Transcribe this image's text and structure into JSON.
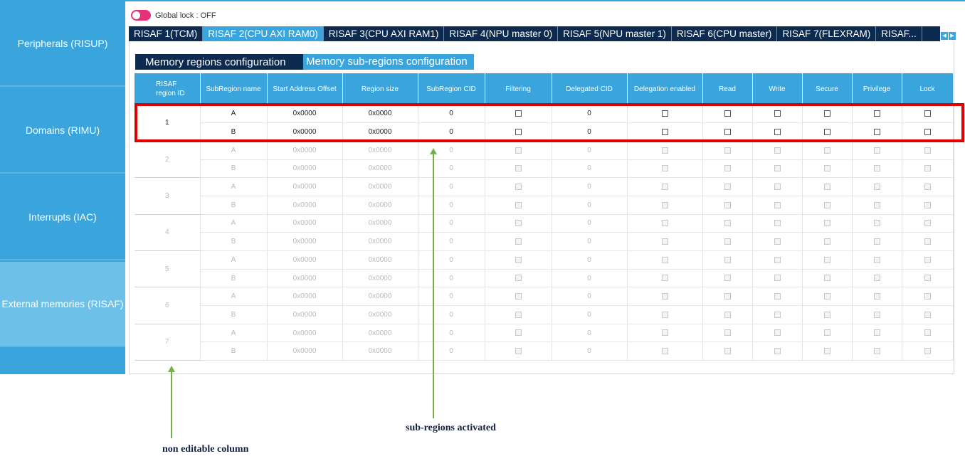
{
  "sidebar": {
    "items": [
      {
        "label": "Peripherals (RISUP)"
      },
      {
        "label": "Domains (RIMU)"
      },
      {
        "label": "Interrupts (IAC)"
      },
      {
        "label": "External memories (RISAF)"
      }
    ]
  },
  "global_lock": {
    "label": "Global lock : OFF"
  },
  "tabs": [
    {
      "label": "RISAF 1(TCM)"
    },
    {
      "label": "RISAF 2(CPU AXI RAM0)"
    },
    {
      "label": "RISAF 3(CPU AXI RAM1)"
    },
    {
      "label": "RISAF 4(NPU master 0)"
    },
    {
      "label": "RISAF 5(NPU master 1)"
    },
    {
      "label": "RISAF 6(CPU master)"
    },
    {
      "label": "RISAF 7(FLEXRAM)"
    },
    {
      "label": "RISAF..."
    }
  ],
  "subtabs": [
    {
      "label": "Memory regions configuration"
    },
    {
      "label": "Memory sub-regions configuration"
    }
  ],
  "table": {
    "headers": [
      "RISAF region ID",
      "SubRegion name",
      "Start Address Offset",
      "Region size",
      "SubRegion CID",
      "Filtering",
      "Delegated CID",
      "Delegation enabled",
      "Read",
      "Write",
      "Secure",
      "Privilege",
      "Lock"
    ],
    "regions": [
      {
        "id": "1",
        "active": true,
        "rows": [
          {
            "name": "A",
            "start": "0x0000",
            "size": "0x0000",
            "cid": "0",
            "dcid": "0"
          },
          {
            "name": "B",
            "start": "0x0000",
            "size": "0x0000",
            "cid": "0",
            "dcid": "0"
          }
        ]
      },
      {
        "id": "2",
        "active": false,
        "rows": [
          {
            "name": "A",
            "start": "0x0000",
            "size": "0x0000",
            "cid": "0",
            "dcid": "0"
          },
          {
            "name": "B",
            "start": "0x0000",
            "size": "0x0000",
            "cid": "0",
            "dcid": "0"
          }
        ]
      },
      {
        "id": "3",
        "active": false,
        "rows": [
          {
            "name": "A",
            "start": "0x0000",
            "size": "0x0000",
            "cid": "0",
            "dcid": "0"
          },
          {
            "name": "B",
            "start": "0x0000",
            "size": "0x0000",
            "cid": "0",
            "dcid": "0"
          }
        ]
      },
      {
        "id": "4",
        "active": false,
        "rows": [
          {
            "name": "A",
            "start": "0x0000",
            "size": "0x0000",
            "cid": "0",
            "dcid": "0"
          },
          {
            "name": "B",
            "start": "0x0000",
            "size": "0x0000",
            "cid": "0",
            "dcid": "0"
          }
        ]
      },
      {
        "id": "5",
        "active": false,
        "rows": [
          {
            "name": "A",
            "start": "0x0000",
            "size": "0x0000",
            "cid": "0",
            "dcid": "0"
          },
          {
            "name": "B",
            "start": "0x0000",
            "size": "0x0000",
            "cid": "0",
            "dcid": "0"
          }
        ]
      },
      {
        "id": "6",
        "active": false,
        "rows": [
          {
            "name": "A",
            "start": "0x0000",
            "size": "0x0000",
            "cid": "0",
            "dcid": "0"
          },
          {
            "name": "B",
            "start": "0x0000",
            "size": "0x0000",
            "cid": "0",
            "dcid": "0"
          }
        ]
      },
      {
        "id": "7",
        "active": false,
        "rows": [
          {
            "name": "A",
            "start": "0x0000",
            "size": "0x0000",
            "cid": "0",
            "dcid": "0"
          },
          {
            "name": "B",
            "start": "0x0000",
            "size": "0x0000",
            "cid": "0",
            "dcid": "0"
          }
        ]
      }
    ]
  },
  "annotations": {
    "subregions": "sub-regions activated",
    "noneditable": "non editable column"
  },
  "colors": {
    "accent": "#3aa5dc",
    "navy": "#0d2a4f",
    "highlight": "#e00000",
    "arrow": "#77b04a",
    "toggle_off": "#e8307a"
  }
}
